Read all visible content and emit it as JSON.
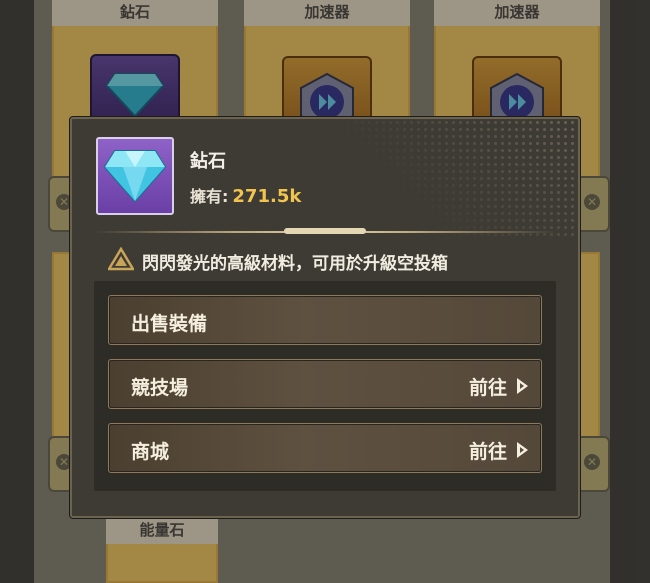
{
  "background": {
    "cards_top": [
      {
        "title": "鉆石",
        "icon": "diamond-icon"
      },
      {
        "title": "加速器",
        "icon": "speed-up-icon"
      },
      {
        "title": "加速器",
        "icon": "speed-up-icon"
      }
    ],
    "cards_bottom": [
      {
        "title": "能量石",
        "icon": "energy-stone-icon"
      }
    ]
  },
  "popup": {
    "item_name": "鉆石",
    "owned_label": "擁有:",
    "owned_value": "271.5k",
    "description": "閃閃發光的高級材料，可用於升級空投箱",
    "actions": [
      {
        "label": "出售裝備",
        "go_label": ""
      },
      {
        "label": "競技場",
        "go_label": "前往"
      },
      {
        "label": "商城",
        "go_label": "前往"
      }
    ]
  },
  "colors": {
    "accent_gold": "#f2c44f",
    "popup_bg": "#3e3b34",
    "item_frame": "#8e62c7"
  }
}
